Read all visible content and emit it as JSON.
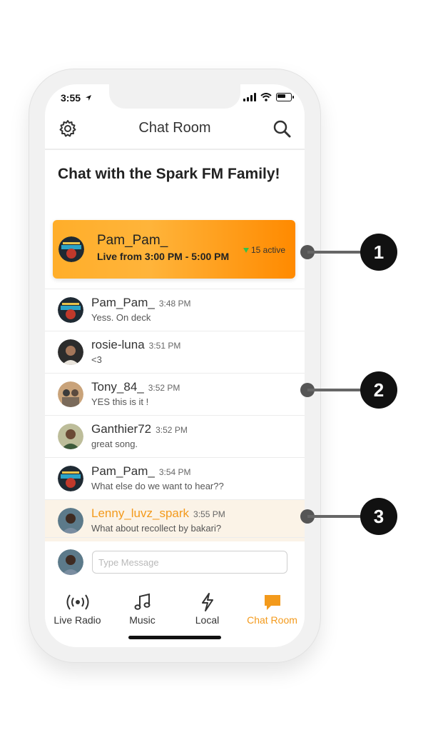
{
  "status_bar": {
    "time": "3:55"
  },
  "header": {
    "title": "Chat Room"
  },
  "page_heading": "Chat with the Spark FM Family!",
  "host_banner": {
    "name": "Pam_Pam_",
    "schedule": "Live from 3:00 PM - 5:00 PM",
    "active_count": "15 active"
  },
  "messages": [
    {
      "user": "Pam_Pam_",
      "time": "3:48 PM",
      "text": "Yess. On deck",
      "avatar": "dj-avatar"
    },
    {
      "user": "rosie-luna",
      "time": "3:51 PM",
      "text": "<3",
      "avatar": "woman-avatar"
    },
    {
      "user": "Tony_84_",
      "time": "3:52 PM",
      "text": "YES this is it !",
      "avatar": "couple-avatar"
    },
    {
      "user": "Ganthier72",
      "time": "3:52 PM",
      "text": "great song.",
      "avatar": "man-avatar"
    },
    {
      "user": "Pam_Pam_",
      "time": "3:54 PM",
      "text": "What else do we want to hear??",
      "avatar": "dj-avatar"
    },
    {
      "user": "Lenny_luvz_spark",
      "time": "3:55 PM",
      "text": "What about recollect by bakari?",
      "avatar": "user-avatar"
    }
  ],
  "message_input": {
    "placeholder": "Type Message",
    "value": ""
  },
  "nav": [
    {
      "label": "Live Radio",
      "icon": "broadcast-icon"
    },
    {
      "label": "Music",
      "icon": "music-note-icon"
    },
    {
      "label": "Local",
      "icon": "lightning-icon"
    },
    {
      "label": "Chat Room",
      "icon": "chat-bubble-icon"
    }
  ],
  "callouts": [
    "1",
    "2",
    "3"
  ],
  "colors": {
    "accent": "#f39a1c",
    "banner_start": "#ffae2a",
    "banner_end": "#ff8a00",
    "highlight_row": "#fbf3e7"
  }
}
